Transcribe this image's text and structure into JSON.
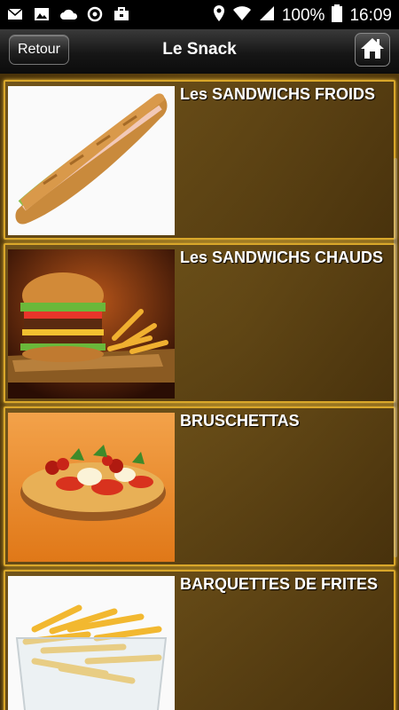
{
  "status_bar": {
    "left_icons": [
      "mail-icon",
      "image-icon",
      "cloud-icon",
      "sync-icon",
      "briefcase-icon"
    ],
    "battery_percent": "100%",
    "time": "16:09"
  },
  "header": {
    "back_label": "Retour",
    "title": "Le Snack",
    "home_icon": "home-icon"
  },
  "menu": [
    {
      "label": "Les SANDWICHS FROIDS",
      "image": "baguette-sandwich"
    },
    {
      "label": "Les SANDWICHS CHAUDS",
      "image": "burger-and-fries"
    },
    {
      "label": "BRUSCHETTAS",
      "image": "bruschetta"
    },
    {
      "label": "BARQUETTES DE FRITES",
      "image": "fries-tray"
    }
  ]
}
